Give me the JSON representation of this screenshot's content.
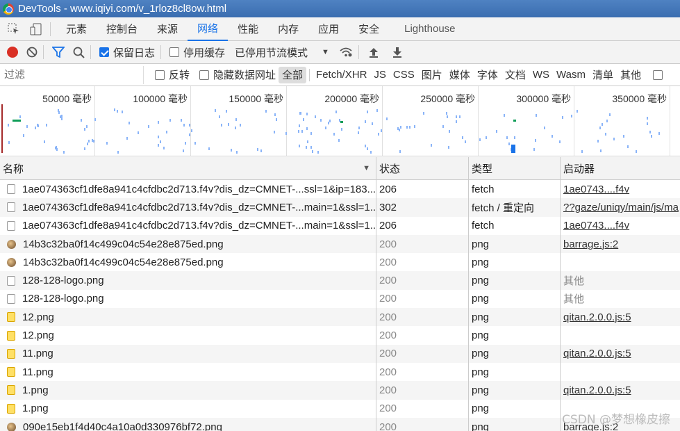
{
  "window": {
    "title": "DevTools - www.iqiyi.com/v_1rloz8cl8ow.html"
  },
  "tabs": [
    {
      "label": "元素"
    },
    {
      "label": "控制台"
    },
    {
      "label": "来源"
    },
    {
      "label": "网络"
    },
    {
      "label": "性能"
    },
    {
      "label": "内存"
    },
    {
      "label": "应用"
    },
    {
      "label": "安全"
    },
    {
      "label": "Lighthouse"
    }
  ],
  "active_tab": "网络",
  "toolbar": {
    "preserve_log_label": "保留日志",
    "preserve_log_checked": true,
    "disable_cache_label": "停用缓存",
    "disable_cache_checked": false,
    "throttling_label": "已停用节流模式"
  },
  "filter": {
    "placeholder": "过滤",
    "invert_label": "反转",
    "hide_data_urls_label": "隐藏数据网址",
    "types": [
      "全部",
      "Fetch/XHR",
      "JS",
      "CSS",
      "图片",
      "媒体",
      "字体",
      "文档",
      "WS",
      "Wasm",
      "清单",
      "其他"
    ],
    "active_type": "全部"
  },
  "overview": {
    "ticks": [
      "50000 毫秒",
      "100000 毫秒",
      "150000 毫秒",
      "200000 毫秒",
      "250000 毫秒",
      "300000 毫秒",
      "350000 毫秒"
    ]
  },
  "table": {
    "headers": {
      "name": "名称",
      "status": "状态",
      "type": "类型",
      "initiator": "启动器"
    },
    "rows": [
      {
        "name": "1ae074363cf1dfe8a941c4cfdbc2d713.f4v?dis_dz=CMNET-...ssl=1&ip=183....",
        "status": "206",
        "type": "fetch",
        "initiator": "1ae0743....f4v",
        "icon": "doc",
        "dim": false
      },
      {
        "name": "1ae074363cf1dfe8a941c4cfdbc2d713.f4v?dis_dz=CMNET-...main=1&ssl=1...",
        "status": "302",
        "type": "fetch / 重定向",
        "initiator": "??gaze/uniqy/main/js/ma",
        "icon": "doc",
        "dim": false
      },
      {
        "name": "1ae074363cf1dfe8a941c4cfdbc2d713.f4v?dis_dz=CMNET-...main=1&ssl=1...",
        "status": "206",
        "type": "fetch",
        "initiator": "1ae0743....f4v",
        "icon": "doc",
        "dim": false
      },
      {
        "name": "14b3c32ba0f14c499c04c54e28e875ed.png",
        "status": "200",
        "type": "png",
        "initiator": "barrage.js:2",
        "icon": "img",
        "dim": true
      },
      {
        "name": "14b3c32ba0f14c499c04c54e28e875ed.png",
        "status": "200",
        "type": "png",
        "initiator": "",
        "icon": "img",
        "dim": true
      },
      {
        "name": "128-128-logo.png",
        "status": "200",
        "type": "png",
        "initiator": "其他",
        "icon": "doc",
        "dim": true
      },
      {
        "name": "128-128-logo.png",
        "status": "200",
        "type": "png",
        "initiator": "其他",
        "icon": "doc",
        "dim": true
      },
      {
        "name": "12.png",
        "status": "200",
        "type": "png",
        "initiator": "qitan.2.0.0.js:5",
        "icon": "emoji",
        "dim": true
      },
      {
        "name": "12.png",
        "status": "200",
        "type": "png",
        "initiator": "",
        "icon": "emoji",
        "dim": true
      },
      {
        "name": "11.png",
        "status": "200",
        "type": "png",
        "initiator": "qitan.2.0.0.js:5",
        "icon": "emoji",
        "dim": true
      },
      {
        "name": "11.png",
        "status": "200",
        "type": "png",
        "initiator": "",
        "icon": "emoji",
        "dim": true
      },
      {
        "name": "1.png",
        "status": "200",
        "type": "png",
        "initiator": "qitan.2.0.0.js:5",
        "icon": "emoji",
        "dim": true
      },
      {
        "name": "1.png",
        "status": "200",
        "type": "png",
        "initiator": "",
        "icon": "emoji",
        "dim": true
      },
      {
        "name": "090e15eb1f4d40c4a10a0d330976bf72.png",
        "status": "200",
        "type": "png",
        "initiator": "barrage.js:2",
        "icon": "img",
        "dim": true
      }
    ]
  },
  "watermark": "CSDN @梦想橡皮擦"
}
